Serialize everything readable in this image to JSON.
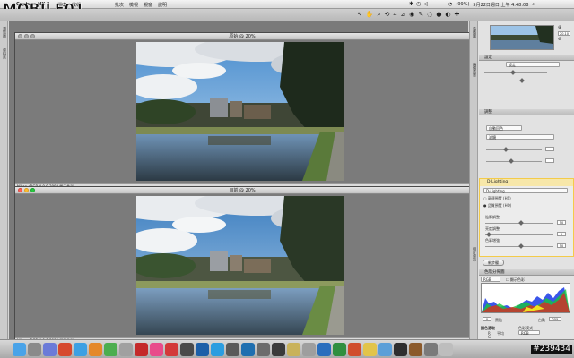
{
  "menubar": {
    "app_name": "Capture NX 2",
    "menus": [
      "檔案",
      "編輯"
    ],
    "menus2": [
      "批次",
      "檢視",
      "視窗",
      "說明"
    ],
    "clock": "5月22日週日 上午 4:48:08",
    "battery": "(99%)"
  },
  "watermark": {
    "text": "MOBILE01"
  },
  "left_strip": {
    "labels": [
      "瀏覽器",
      "資料夾"
    ]
  },
  "windows": [
    {
      "title": "原始 @ 20%",
      "footer": "Nikon sRGB 4.0.0.3002  顯示色彩"
    },
    {
      "title": "目前 @ 20%",
      "footer": "Nikon sRGB 4.0.0.3002  顯示色彩"
    }
  ],
  "right_panel": {
    "tabs": [
      "鳥瞰圖",
      "編輯清單",
      "相片資訊"
    ],
    "zoom": "20.10",
    "adjust_header": "調整",
    "base_dropdown": "設定",
    "step_dropdown": "自動回色",
    "step2_dropdown": "濾鏡",
    "dlighting_title": "D-Lighting",
    "dlighting_dropdown": "D-Lighting",
    "option_high_speed": "高速預覽 (HS)",
    "option_hq": "品質預覽 (HQ)",
    "slider_labels": [
      "陰影調整",
      "亮度調整",
      "色彩增強"
    ],
    "slider_values": [
      "50",
      "0",
      "50"
    ],
    "new_step_button": "新步驟",
    "histogram_header": "色階分佈圖",
    "histogram_channel": "RGB",
    "histogram_check": "顯示色彩",
    "black_label": "黑點",
    "white_label": "白點",
    "histogram_values": [
      "0",
      "255"
    ],
    "color_picker_header": "顏色選取",
    "picker_mode_label": "色彩模式",
    "picker_mode_value": "RGB",
    "picker_sample_label": "取樣大小",
    "picker_sample_value": "平均 3x3",
    "picker_rgb": [
      "R",
      "G",
      "B"
    ],
    "picker_avg": "平均"
  },
  "photo_id": "#239434",
  "colors": {
    "accent": "#f3cb4a",
    "sky": "#7db6e0"
  }
}
